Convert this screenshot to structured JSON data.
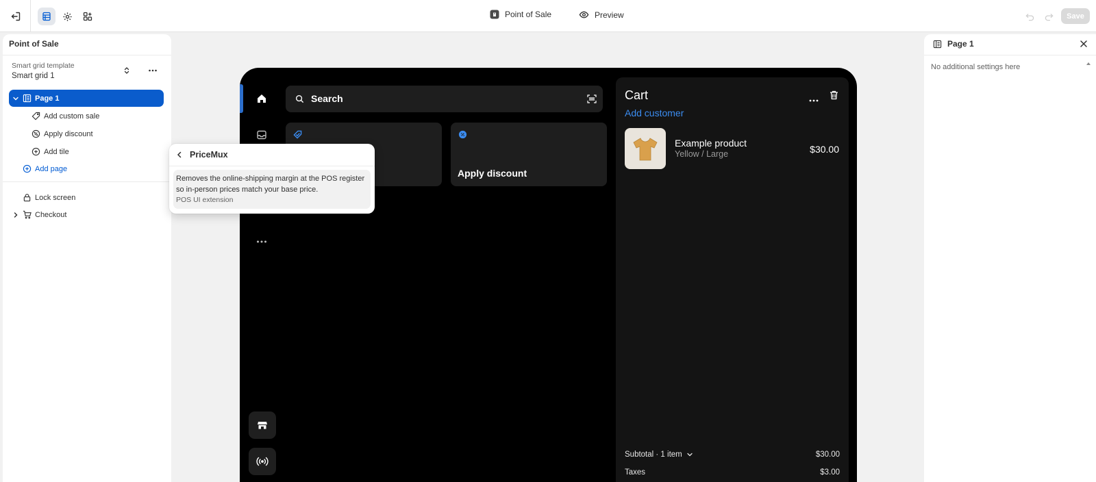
{
  "topbar": {
    "center_title": "Point of Sale",
    "preview_label": "Preview",
    "save_label": "Save"
  },
  "left_panel": {
    "title": "Point of Sale",
    "template_label": "Smart grid template",
    "template_value": "Smart grid 1",
    "items": [
      {
        "label": "Page 1",
        "icon": "layout-icon"
      },
      {
        "label": "Add custom sale",
        "icon": "tag-icon"
      },
      {
        "label": "Apply discount",
        "icon": "discount-icon"
      },
      {
        "label": "Add tile",
        "icon": "plus-circle-icon"
      },
      {
        "label": "Add page",
        "icon": "plus-circle-icon"
      },
      {
        "label": "Lock screen",
        "icon": "lock-icon"
      },
      {
        "label": "Checkout",
        "icon": "cart-icon"
      }
    ]
  },
  "pos": {
    "search_placeholder": "Search",
    "tiles": [
      {
        "label": ""
      },
      {
        "label": "Apply discount"
      }
    ],
    "cart": {
      "title": "Cart",
      "add_customer": "Add customer",
      "product_name": "Example product",
      "product_variant": "Yellow / Large",
      "product_price": "$30.00",
      "subtotal_label": "Subtotal · 1 item",
      "subtotal_value": "$30.00",
      "taxes_label": "Taxes",
      "taxes_value": "$3.00"
    }
  },
  "popover": {
    "title": "PriceMux",
    "description": "Removes the online-shipping margin at the POS register so in-person prices match your base price.",
    "subtitle": "POS UI extension"
  },
  "right_panel": {
    "title": "Page 1",
    "note": "No additional settings here"
  },
  "colors": {
    "accent": "#0a5ccc",
    "link": "#005bd3",
    "pos_link": "#3b8cf0"
  }
}
